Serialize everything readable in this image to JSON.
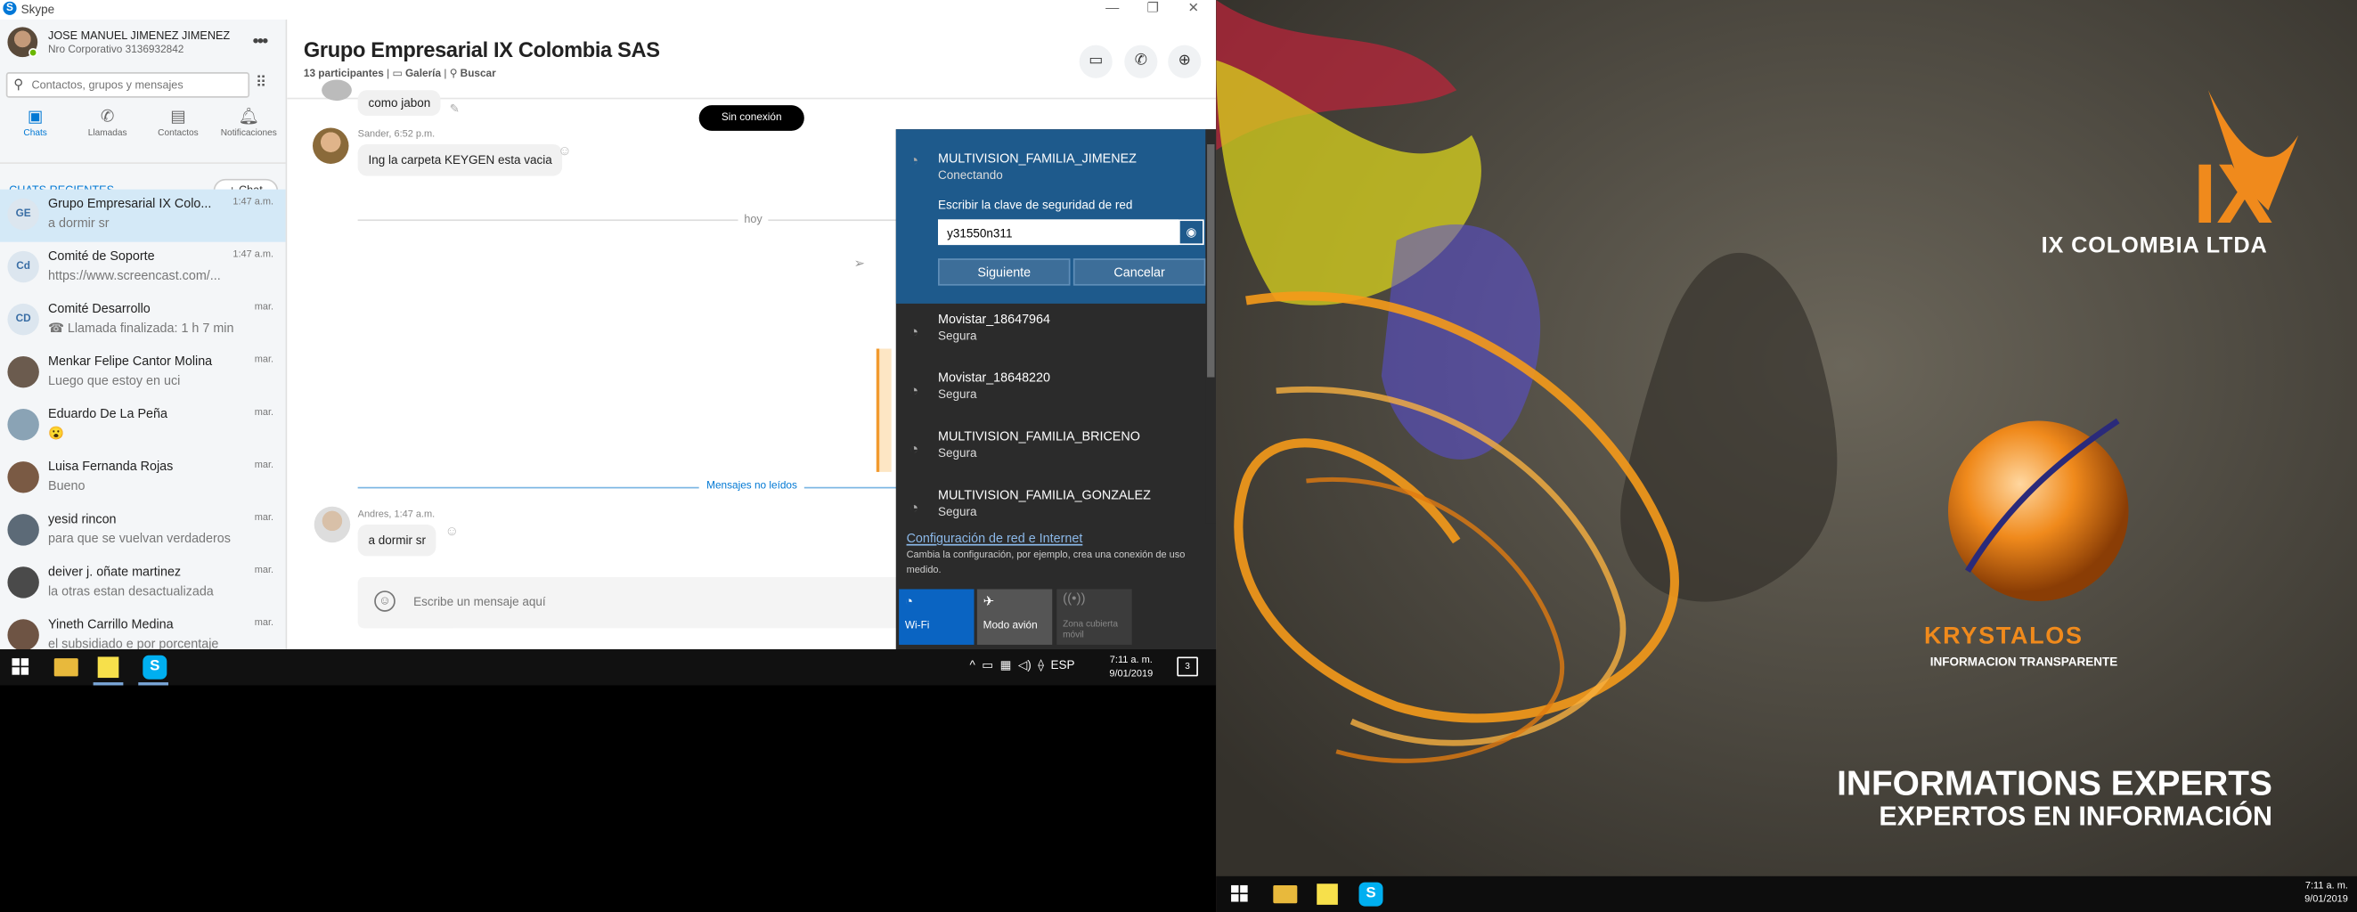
{
  "window": {
    "app_title": "Skype"
  },
  "profile": {
    "name": "JOSE MANUEL JIMENEZ JIMENEZ",
    "status": "Nro Corporativo 3136932842"
  },
  "search": {
    "placeholder": "Contactos, grupos y mensajes"
  },
  "nav_tabs": [
    {
      "label": "Chats",
      "icon": "chat-icon"
    },
    {
      "label": "Llamadas",
      "icon": "phone-icon"
    },
    {
      "label": "Contactos",
      "icon": "contacts-icon"
    },
    {
      "label": "Notificaciones",
      "icon": "bell-icon"
    }
  ],
  "recent_label": "CHATS RECIENTES",
  "new_chat_label": "Chat",
  "chats": [
    {
      "name": "Grupo Empresarial IX Colo...",
      "message": "a dormir sr",
      "time": "1:47 a.m.",
      "initials": "GE"
    },
    {
      "name": "Comité de Soporte",
      "message": "https://www.screencast.com/...",
      "time": "1:47 a.m.",
      "initials": "Cd"
    },
    {
      "name": "Comité Desarrollo",
      "message": "Llamada finalizada: 1 h 7 min",
      "time": "mar.",
      "initials": "CD"
    },
    {
      "name": "Menkar Felipe Cantor Molina",
      "message": "Luego que estoy en uci",
      "time": "mar.",
      "initials": ""
    },
    {
      "name": "Eduardo De La Peña",
      "message": "😮",
      "time": "mar.",
      "initials": ""
    },
    {
      "name": "Luisa Fernanda Rojas",
      "message": "Bueno",
      "time": "mar.",
      "initials": ""
    },
    {
      "name": "yesid rincon",
      "message": "para que se vuelvan  verdaderos ...",
      "time": "mar.",
      "initials": ""
    },
    {
      "name": "deiver j. oñate martinez",
      "message": "la otras estan desactualizada",
      "time": "mar.",
      "initials": ""
    },
    {
      "name": "Yineth Carrillo Medina",
      "message": "el subsidiado e por porcentaje",
      "time": "mar.",
      "initials": ""
    }
  ],
  "conversation": {
    "title": "Grupo Empresarial IX Colombia SAS",
    "participants": "13 participantes",
    "gallery": "Galería",
    "search": "Buscar",
    "offline_badge": "Sin conexión",
    "messages": [
      {
        "text": "como jabon"
      },
      {
        "sender": "Sander, 6:52 p.m.",
        "text": "Ing la carpeta KEYGEN esta vacia"
      },
      {
        "sender": "Andres, 1:47 a.m.",
        "text": "a dormir sr"
      }
    ],
    "day_separator": "hoy",
    "unread_separator": "Mensajes no leídos",
    "compose_placeholder": "Escribe un mensaje aquí"
  },
  "network_flyout": {
    "connecting": {
      "name": "MULTIVISION_FAMILIA_JIMENEZ",
      "status": "Conectando"
    },
    "key_prompt": "Escribir la clave de seguridad de red",
    "key_value": "y31550n311",
    "next_button": "Siguiente",
    "cancel_button": "Cancelar",
    "networks": [
      {
        "name": "Movistar_18647964",
        "status": "Segura"
      },
      {
        "name": "Movistar_18648220",
        "status": "Segura"
      },
      {
        "name": "MULTIVISION_FAMILIA_BRICENO",
        "status": "Segura"
      },
      {
        "name": "MULTIVISION_FAMILIA_GONZALEZ",
        "status": "Segura"
      }
    ],
    "settings_link": "Configuración de red e Internet",
    "settings_desc": "Cambia la configuración, por ejemplo, crea una conexión de uso medido.",
    "quick_actions": [
      {
        "label": "Wi-Fi",
        "active": true
      },
      {
        "label": "Modo avión",
        "active": false
      },
      {
        "label": "Zona cubierta móvil",
        "active": false
      }
    ]
  },
  "taskbar_left": {
    "tray": "ESP",
    "time": "7:11 a. m.",
    "date": "9/01/2019",
    "notifications": "3"
  },
  "taskbar_right": {
    "time": "7:11 a. m.",
    "date": "9/01/2019"
  },
  "wallpaper": {
    "logo_text": "IX COLOMBIA LTDA",
    "brand": "KRYSTALOS",
    "brand_sub": "INFORMACION TRANSPARENTE",
    "headline": "INFORMATIONS EXPERTS",
    "subheadline": "EXPERTOS EN INFORMACIÓN"
  },
  "colors": {
    "skype_blue": "#0078d4",
    "selected_chat": "#d4e9f7",
    "flyout_bg": "#2b2b2b",
    "flyout_accent": "#1e5a8c",
    "brand_orange": "#f08a1c"
  }
}
